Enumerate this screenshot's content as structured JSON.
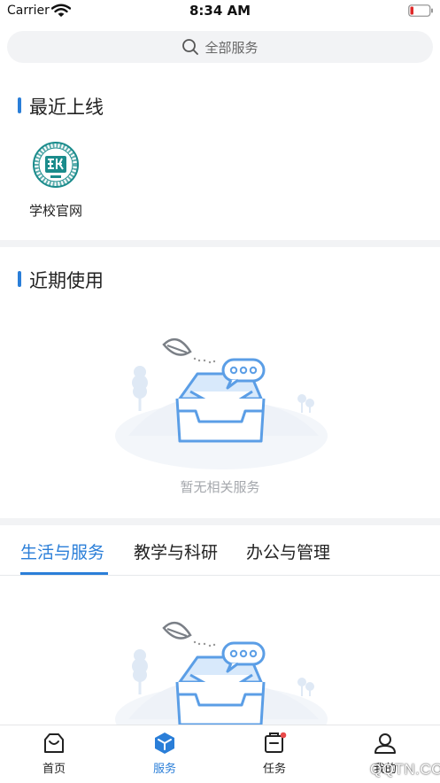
{
  "status_bar": {
    "carrier": "Carrier",
    "time": "8:34 AM"
  },
  "search": {
    "placeholder": "全部服务"
  },
  "recent_online": {
    "title": "最近上线",
    "apps": [
      {
        "label": "学校官网",
        "icon": "school-emblem-icon"
      }
    ]
  },
  "recent_use": {
    "title": "近期使用",
    "empty_text": "暂无相关服务"
  },
  "category_tabs": [
    {
      "label": "生活与服务",
      "active": true
    },
    {
      "label": "教学与科研",
      "active": false
    },
    {
      "label": "办公与管理",
      "active": false
    }
  ],
  "bottom_nav": [
    {
      "label": "首页",
      "icon": "home-inbox-icon",
      "active": false
    },
    {
      "label": "服务",
      "icon": "service-cube-icon",
      "active": true
    },
    {
      "label": "任务",
      "icon": "task-icon",
      "active": false,
      "badge": true
    },
    {
      "label": "我的",
      "icon": "profile-icon",
      "active": false
    }
  ],
  "watermark": "QQTN.COM",
  "colors": {
    "accent": "#2a7ed8",
    "background_gray": "#f2f3f5",
    "badge": "#e84a4a",
    "empty_illustration": "#5b9ee6"
  }
}
